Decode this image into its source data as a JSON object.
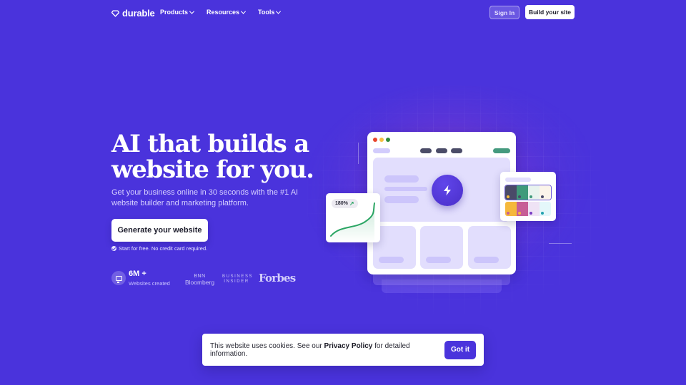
{
  "nav": {
    "brand": "durable",
    "menu": [
      {
        "label": "Products"
      },
      {
        "label": "Resources"
      },
      {
        "label": "Tools"
      }
    ],
    "sign_in": "Sign In",
    "build_site": "Build your site"
  },
  "hero": {
    "headline_line1": "AI that builds a",
    "headline_line2": "website for you.",
    "subtitle": "Get your business online in 30 seconds with the #1 AI website builder and marketing platform.",
    "cta": "Generate your website",
    "free_note": "Start for free. No credit card required.",
    "stat_value": "6M +",
    "stat_label": "Websites created",
    "press": {
      "bnn_top": "BNN",
      "bnn_bottom": "Bloomberg",
      "bi_top": "BUSINESS",
      "bi_bottom": "INSIDER",
      "forbes": "Forbes"
    }
  },
  "illustration": {
    "growth_badge": "180%",
    "window_dots": [
      "#e8452e",
      "#f5c042",
      "#2e8b3a"
    ],
    "palette_rows": [
      {
        "swatches": [
          "#4a4a68",
          "#3f9a7a",
          "#e8f3ee",
          "#fbf4ea"
        ],
        "dots": [
          "#f5b83c",
          "#4a4a68",
          "#3f9a7a",
          "#4a4a68"
        ],
        "selected": true
      },
      {
        "swatches": [
          "#f5b83c",
          "#c75e96",
          "#efe3f5",
          "#e4f7fa"
        ],
        "dots": [
          "#c75e96",
          "#f5b83c",
          "#7a3cc4",
          "#22a3b0"
        ],
        "selected": false
      }
    ]
  },
  "cookie": {
    "text_before": "This website uses cookies. See our ",
    "link": "Privacy Policy",
    "text_after": " for detailed information.",
    "button": "Got it"
  },
  "colors": {
    "background": "#4a33dc",
    "accent": "#4a33dc",
    "nav_pill_dark": "#4b4c68",
    "nav_pill_green": "#459a7f",
    "growth_line": "#2aa563"
  }
}
